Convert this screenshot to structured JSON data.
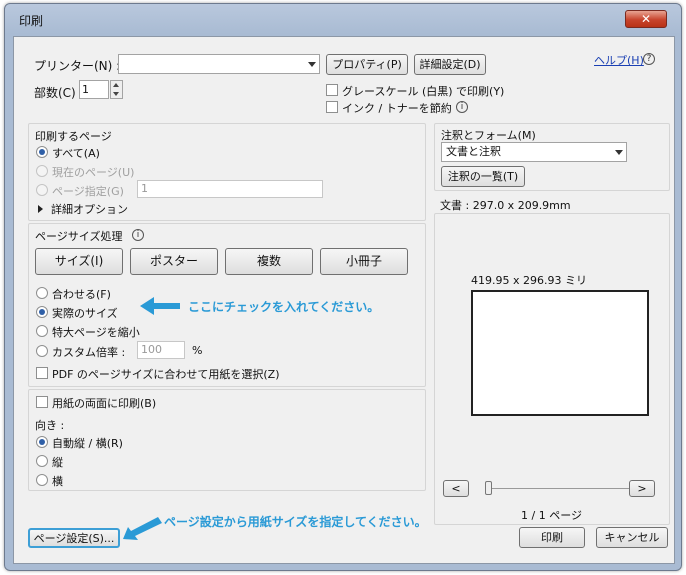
{
  "window": {
    "title": "印刷",
    "close_glyph": "✕"
  },
  "printer": {
    "label": "プリンター(N) :",
    "value": "",
    "properties_label": "プロパティ(P)",
    "advanced_label": "詳細設定(D)",
    "help_label": "ヘルプ(H)"
  },
  "copies": {
    "label": "部数(C) :",
    "value": "1"
  },
  "options": {
    "grayscale_label": "グレースケール (白黒) で印刷(Y)",
    "saveink_label": "インク / トナーを節約"
  },
  "pages": {
    "title": "印刷するページ",
    "all_label": "すべて(A)",
    "current_label": "現在のページ(U)",
    "range_label": "ページ指定(G)",
    "range_value": "1",
    "more_label": "詳細オプション"
  },
  "sizing": {
    "title": "ページサイズ処理",
    "buttons": [
      "サイズ(I)",
      "ポスター",
      "複数",
      "小冊子"
    ],
    "fit_label": "合わせる(F)",
    "actual_label": "実際のサイズ",
    "shrink_label": "特大ページを縮小",
    "custom_label": "カスタム倍率 :",
    "custom_value": "100",
    "percent": "%",
    "pdf_paper_label": "PDF のページサイズに合わせて用紙を選択(Z)"
  },
  "duplex": {
    "label": "用紙の両面に印刷(B)"
  },
  "orientation": {
    "title": "向き :",
    "auto_label": "自動縦 / 横(R)",
    "portrait_label": "縦",
    "landscape_label": "横"
  },
  "annotations": {
    "title": "注釈とフォーム(M)",
    "value": "文書と注釈",
    "summary_label": "注釈の一覧(T)"
  },
  "preview": {
    "doc_label": "文書 : 297.0 x 209.9mm",
    "paper_label": "419.95 x 296.93 ミリ",
    "prev_label": "<",
    "next_label": ">",
    "page_label": "1 / 1 ページ"
  },
  "footer": {
    "page_setup_label": "ページ設定(S)...",
    "print_label": "印刷",
    "cancel_label": "キャンセル"
  },
  "notes": {
    "actual_note": "ここにチェックを入れてください。",
    "setup_note": "ページ設定から用紙サイズを指定してください。"
  },
  "colors": {
    "note": "#2a9ad6",
    "radio_selected": "#2f5fa7",
    "title_bar": "#a9bbd3",
    "close_button": "#c8442c"
  }
}
